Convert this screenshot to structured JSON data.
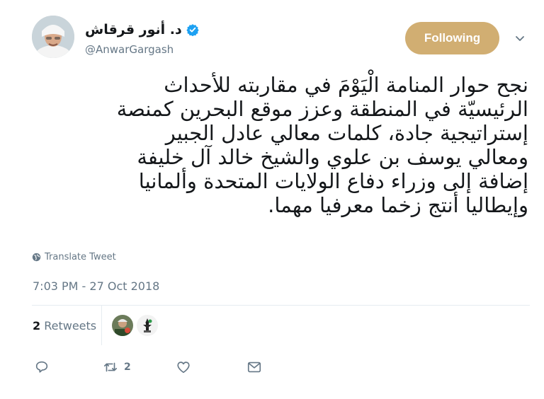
{
  "user": {
    "name": "د. أنور قرقاش",
    "handle": "@AnwarGargash"
  },
  "follow_button": {
    "label": "Following"
  },
  "tweet": {
    "lines": [
      "نجح حوار المنامة الْيَوْمَ في مقاربته للأحداث",
      "الرئيسيّة في المنطقة وعزز موقع البحرين كمنصة",
      "إستراتيجية جادة، كلمات معالي عادل الجبير",
      "ومعالي يوسف بن علوي والشيخ خالد آل خليفة",
      "إضافة إلى وزراء دفاع الولايات المتحدة وألمانيا",
      "وإيطاليا أنتج زخما معرفيا مهما."
    ],
    "translate_label": "Translate Tweet",
    "timestamp": "7:03 PM - 27 Oct 2018"
  },
  "stats": {
    "retweet_count": "2",
    "retweet_label": "Retweets"
  },
  "actions": {
    "reply_icon": "reply-icon",
    "retweet_icon": "retweet-icon",
    "retweet_count": "2",
    "like_icon": "heart-icon",
    "message_icon": "envelope-icon"
  },
  "colors": {
    "follow_button": "#d1ae72",
    "verified": "#1da1f2",
    "secondary_text": "#657786"
  }
}
